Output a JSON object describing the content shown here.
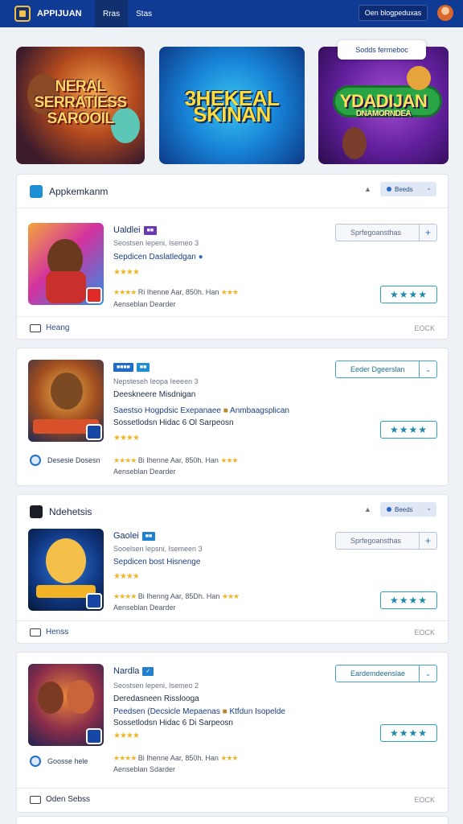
{
  "header": {
    "app_title": "APPIJUAN",
    "tabs": [
      "Rras",
      "Stas"
    ],
    "account_button": "Oen blogpeduxas"
  },
  "banners": [
    {
      "title_line1": "NERAL",
      "title_line2": "SERRATIESS",
      "title_line3": "SAROOIL"
    },
    {
      "title_line1": "3HEKEAL",
      "title_line2": "SKINAN"
    },
    {
      "title_line1": "YDADIJAN",
      "title_sub": "DNAMORNDEA"
    }
  ],
  "banner_chip": "Sodds fermeboc",
  "section1": {
    "title": "Appkemkanm",
    "pill": "Beeds",
    "games": [
      {
        "title": "Ualdlei",
        "lines": [
          "Seostsen lepeni, Isemeo 3",
          "Sepdicen Daslatledgan"
        ],
        "stars_text": "★★★★",
        "meta": "Ri Ihenne Aar, 850h. Han",
        "meta2": "Aenseblan  Dearder",
        "action": "Sprfegoansthas"
      },
      {
        "title": "",
        "lines": [
          "Nepsteseh Ieopa Ieeeen 3",
          "Deeskneere Misdnigan",
          "Saestso Hogpdsic Exepanaee",
          "Sossetlodsn Hidac 6 Ol Sarpeosn"
        ],
        "extra_text": "Anmbaagsplican",
        "stars_text": "★★★★",
        "meta": "Bi Ihenne Aar, 850h. Han",
        "meta2": "Aenseblan  Dearder",
        "circle_label": "Desesie Dosesn",
        "action": "Eeder Dgeerslan"
      }
    ],
    "footer_label": "Heang",
    "footer_right": "EOCK"
  },
  "section2": {
    "title": "Ndehetsis",
    "pill": "Beeds",
    "games": [
      {
        "title": "Gaolei",
        "lines": [
          "Sooelsen lepsni, Isemeen 3",
          "Sepdicen bost Hisnenge"
        ],
        "stars_text": "★★★★",
        "meta": "Bi Ihenng Aar, 85Dh. Han",
        "meta2": "Aenseblan  Dearder",
        "action": "Sprfegoansthas"
      },
      {
        "title": "Nardla",
        "lines": [
          "Seostsen lepeni, Isemeo 2",
          "Deredasneen Risslooga",
          "Peedsen (Decsicle Mepaenas",
          "Sossetlodsn Hidac 6 Di Sarpeosn"
        ],
        "extra_text": "Ktfdun Isopelde",
        "stars_text": "★★★★",
        "meta": "Bi Ihenne Aar, 850h. Han",
        "meta2": "Aenseblan  Sdarder",
        "circle_label": "Goosse hele",
        "action": "Eardemdeenslae"
      }
    ],
    "footer_label1": "Henss",
    "footer_label2": "Oden Sebss",
    "footer_right": "EOCK"
  },
  "rating_stars": "★★★★",
  "colors": {
    "brand": "#0f3b95",
    "accent_teal": "#2ea0b8",
    "star": "#f0b429"
  }
}
